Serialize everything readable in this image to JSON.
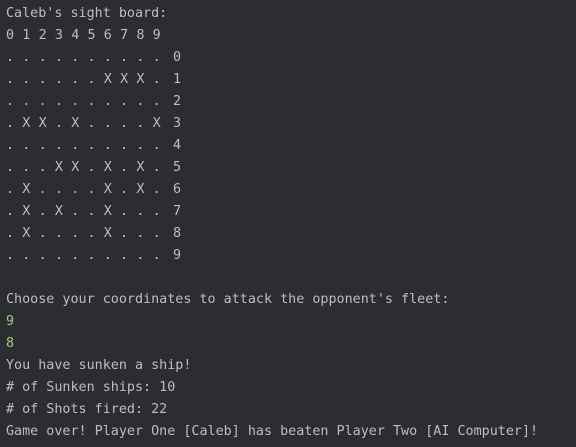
{
  "console": {
    "board_title": "Caleb's sight board:",
    "column_header": [
      "0",
      "1",
      "2",
      "3",
      "4",
      "5",
      "6",
      "7",
      "8",
      "9"
    ],
    "grid": [
      [
        ".",
        ".",
        ".",
        ".",
        ".",
        ".",
        ".",
        ".",
        ".",
        "."
      ],
      [
        ".",
        ".",
        ".",
        ".",
        ".",
        ".",
        "X",
        "X",
        "X",
        "."
      ],
      [
        ".",
        ".",
        ".",
        ".",
        ".",
        ".",
        ".",
        ".",
        ".",
        "."
      ],
      [
        ".",
        "X",
        "X",
        ".",
        "X",
        ".",
        ".",
        ".",
        ".",
        "X"
      ],
      [
        ".",
        ".",
        ".",
        ".",
        ".",
        ".",
        ".",
        ".",
        ".",
        "."
      ],
      [
        ".",
        ".",
        ".",
        "X",
        "X",
        ".",
        "X",
        ".",
        "X",
        "."
      ],
      [
        ".",
        "X",
        ".",
        ".",
        ".",
        ".",
        "X",
        ".",
        "X",
        "."
      ],
      [
        ".",
        "X",
        ".",
        "X",
        ".",
        ".",
        "X",
        ".",
        ".",
        "."
      ],
      [
        ".",
        "X",
        ".",
        ".",
        ".",
        ".",
        "X",
        ".",
        ".",
        "."
      ],
      [
        ".",
        ".",
        ".",
        ".",
        ".",
        ".",
        ".",
        ".",
        ".",
        "."
      ]
    ],
    "row_labels": [
      "0",
      "1",
      "2",
      "3",
      "4",
      "5",
      "6",
      "7",
      "8",
      "9"
    ],
    "prompt": "Choose your coordinates to attack the opponent's fleet:",
    "input_row": "9",
    "input_col": "8",
    "result_msg": "You have sunken a ship!",
    "sunken_msg": "# of Sunken ships: 10",
    "shots_msg": "# of Shots fired: 22",
    "game_over_msg": "Game over! Player One [Caleb] has beaten Player Two [AI Computer]!",
    "colors": {
      "background": "#2b2d30",
      "text": "#bcbec4",
      "user_input": "#a9c77d"
    }
  }
}
